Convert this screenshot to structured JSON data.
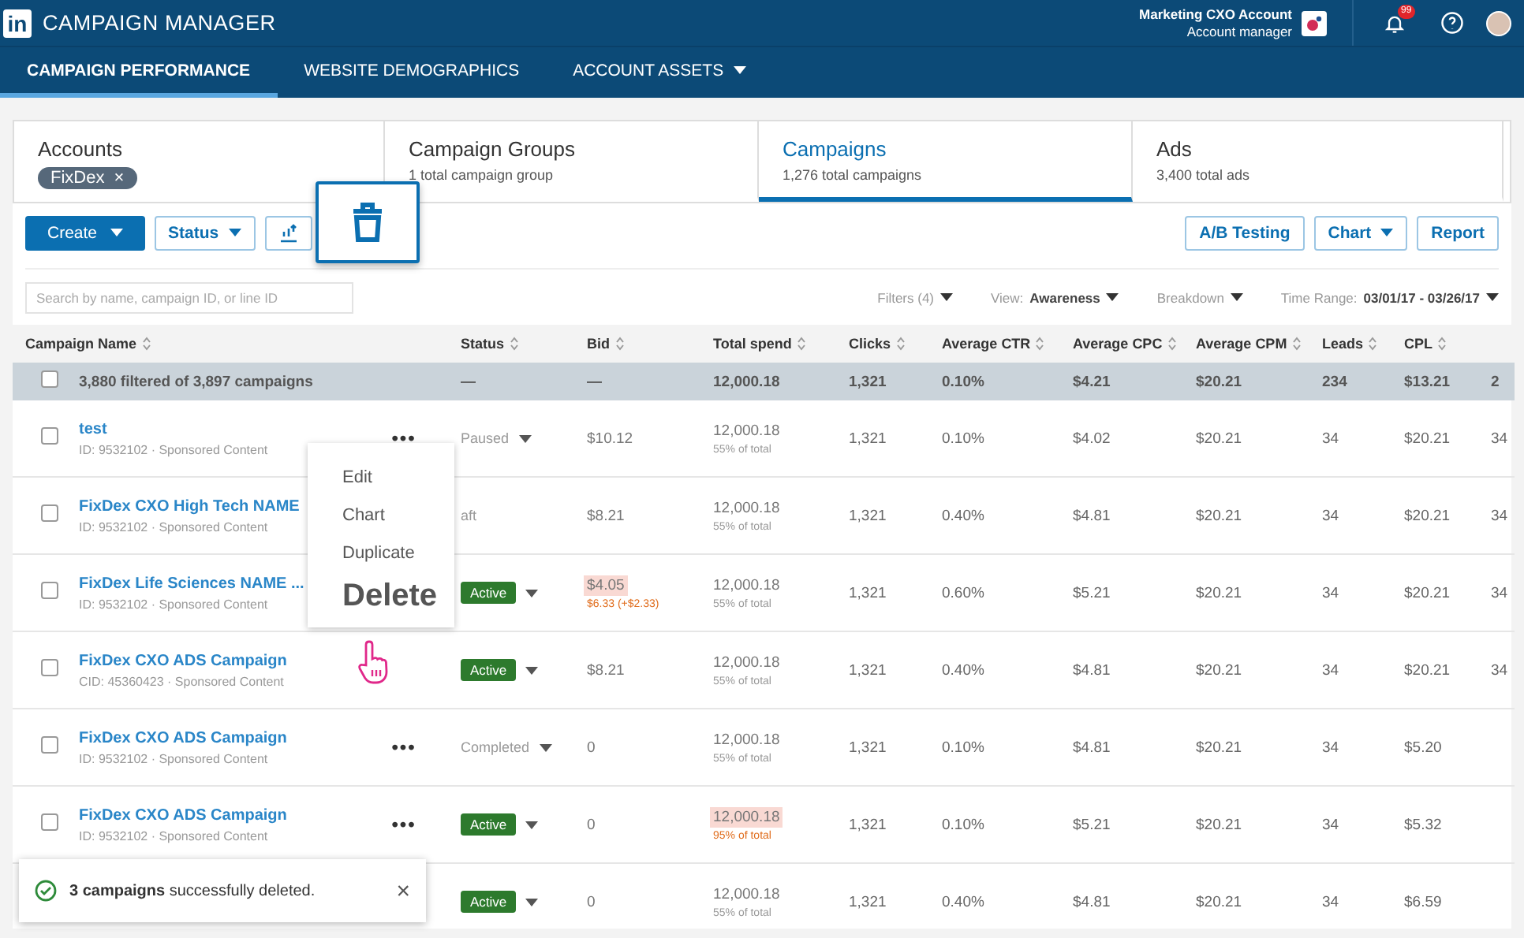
{
  "header": {
    "logo": "in",
    "title": "CAMPAIGN MANAGER",
    "account_name": "Marketing CXO Account",
    "account_role": "Account manager",
    "notification_count": "99"
  },
  "nav": [
    {
      "label": "CAMPAIGN PERFORMANCE",
      "selected": true,
      "dropdown": false
    },
    {
      "label": "WEBSITE DEMOGRAPHICS",
      "selected": false,
      "dropdown": false
    },
    {
      "label": "ACCOUNT ASSETS",
      "selected": false,
      "dropdown": true
    }
  ],
  "summary_cards": [
    {
      "title": "Accounts",
      "chip": "FixDex",
      "chip_remove": "×",
      "selected": false
    },
    {
      "title": "Campaign Groups",
      "subtitle": "1 total campaign group",
      "selected": false
    },
    {
      "title": "Campaigns",
      "subtitle": "1,276 total campaigns",
      "selected": true
    },
    {
      "title": "Ads",
      "subtitle": "3,400 total ads",
      "selected": false
    }
  ],
  "toolbar": {
    "create": "Create",
    "status": "Status",
    "right_buttons": [
      {
        "label": "A/B Testing",
        "dropdown": false
      },
      {
        "label": "Chart",
        "dropdown": true
      },
      {
        "label": "Report",
        "dropdown": false
      }
    ]
  },
  "search": {
    "placeholder": "Search by name, campaign ID, or line ID"
  },
  "filters": [
    {
      "label": "Filters (4)"
    },
    {
      "label": "View:",
      "value": "Awareness"
    },
    {
      "label": "Breakdown"
    },
    {
      "label": "Time Range:",
      "value": "03/01/17 - 03/26/17"
    }
  ],
  "table": {
    "columns": [
      "Campaign Name",
      "Status",
      "Bid",
      "Total spend",
      "Clicks",
      "Average CTR",
      "Average CPC",
      "Average CPM",
      "Leads",
      "CPL"
    ],
    "total_row": {
      "checked": false,
      "label": "3,880 filtered of 3,897 campaigns",
      "status": "—",
      "bid": "—",
      "spend": "12,000.18",
      "clicks": "1,321",
      "ctr": "0.10%",
      "cpc": "$4.21",
      "cpm": "$20.21",
      "leads": "234",
      "cpl": "$13.21",
      "extra": "2"
    },
    "rows": [
      {
        "checked": false,
        "name": "test",
        "meta": "ID: 9532102 · Sponsored Content",
        "more": "•••",
        "status": {
          "kind": "plain",
          "text": "Paused",
          "dropdown": true
        },
        "bid": {
          "text": "$10.12",
          "highlight": false
        },
        "spend": {
          "text": "12,000.18",
          "share": "55% of total",
          "highlight": false
        },
        "clicks": "1,321",
        "ctr": "0.10%",
        "cpc": "$4.02",
        "cpm": "$20.21",
        "leads": "34",
        "cpl": "$20.21",
        "extra": "34"
      },
      {
        "checked": false,
        "name": "FixDex CXO High Tech NAME",
        "meta": "ID: 9532102 · Sponsored Content",
        "status": {
          "kind": "plain",
          "text": "aft",
          "dropdown": false
        },
        "bid": {
          "text": "$8.21",
          "highlight": false
        },
        "spend": {
          "text": "12,000.18",
          "share": "55% of total",
          "highlight": false
        },
        "clicks": "1,321",
        "ctr": "0.40%",
        "cpc": "$4.81",
        "cpm": "$20.21",
        "leads": "34",
        "cpl": "$20.21",
        "extra": "34"
      },
      {
        "checked": false,
        "name": "FixDex Life Sciences NAME ...",
        "meta": "ID: 9532102 · Sponsored Content",
        "status": {
          "kind": "badge",
          "text": "Active",
          "dropdown": true
        },
        "bid": {
          "text": "$4.05",
          "highlight": true,
          "note": "$6.33 (+$2.33)"
        },
        "spend": {
          "text": "12,000.18",
          "share": "55% of total",
          "highlight": false
        },
        "clicks": "1,321",
        "ctr": "0.60%",
        "cpc": "$5.21",
        "cpm": "$20.21",
        "leads": "34",
        "cpl": "$20.21",
        "extra": "34"
      },
      {
        "checked": false,
        "name": "FixDex CXO ADS Campaign",
        "meta": "CID: 45360423 · Sponsored Content",
        "status": {
          "kind": "badge",
          "text": "Active",
          "dropdown": true
        },
        "bid": {
          "text": "$8.21",
          "highlight": false
        },
        "spend": {
          "text": "12,000.18",
          "share": "55% of total",
          "highlight": false
        },
        "clicks": "1,321",
        "ctr": "0.40%",
        "cpc": "$4.81",
        "cpm": "$20.21",
        "leads": "34",
        "cpl": "$20.21",
        "extra": "34"
      },
      {
        "checked": false,
        "name": "FixDex CXO ADS Campaign",
        "meta": "ID: 9532102 · Sponsored Content",
        "more": "•••",
        "status": {
          "kind": "plain",
          "text": "Completed",
          "dropdown": true
        },
        "bid": {
          "text": "0",
          "highlight": false
        },
        "spend": {
          "text": "12,000.18",
          "share": "55% of total",
          "highlight": false
        },
        "clicks": "1,321",
        "ctr": "0.10%",
        "cpc": "$4.81",
        "cpm": "$20.21",
        "leads": "34",
        "cpl": "$5.20"
      },
      {
        "checked": false,
        "name": "FixDex CXO ADS Campaign",
        "meta": "ID: 9532102 · Sponsored Content",
        "more": "•••",
        "status": {
          "kind": "badge",
          "text": "Active",
          "dropdown": true
        },
        "bid": {
          "text": "0",
          "highlight": false
        },
        "spend": {
          "text": "12,000.18",
          "share": "95% of total",
          "highlight": true
        },
        "clicks": "1,321",
        "ctr": "0.10%",
        "cpc": "$5.21",
        "cpm": "$20.21",
        "leads": "34",
        "cpl": "$5.32"
      },
      {
        "status": {
          "kind": "badge",
          "text": "Active",
          "dropdown": true
        },
        "bid": {
          "text": "0",
          "highlight": false
        },
        "spend": {
          "text": "12,000.18",
          "share": "55% of total",
          "highlight": false
        },
        "clicks": "1,321",
        "ctr": "0.40%",
        "cpc": "$4.81",
        "cpm": "$20.21",
        "leads": "34",
        "cpl": "$6.59"
      }
    ]
  },
  "context_menu": [
    {
      "label": "Edit",
      "kind": "normal"
    },
    {
      "label": "Chart",
      "kind": "normal"
    },
    {
      "label": "Duplicate",
      "kind": "normal"
    },
    {
      "label": "Delete",
      "kind": "large"
    }
  ],
  "toast": {
    "text": "**3 campaigns** successfully deleted.",
    "close": "×"
  }
}
